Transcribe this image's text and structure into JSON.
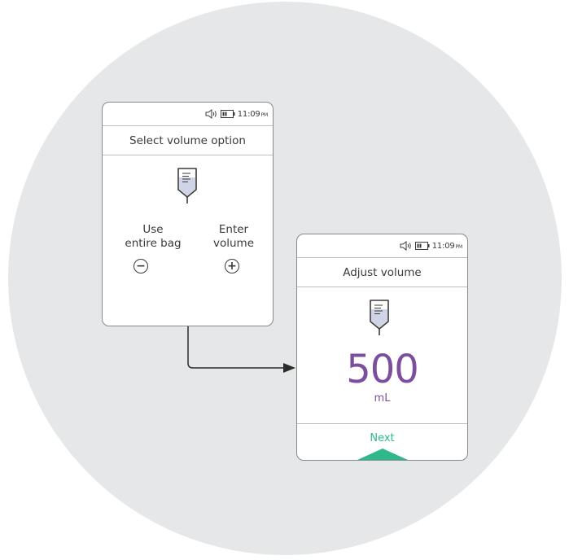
{
  "status_bar": {
    "time": "11:09",
    "ampm": "PM"
  },
  "screen1": {
    "title": "Select volume option",
    "option_entire_bag": {
      "line1": "Use",
      "line2": "entire bag"
    },
    "option_enter_volume": {
      "line1": "Enter",
      "line2": "volume"
    },
    "minus_symbol": "−",
    "plus_symbol": "+"
  },
  "screen2": {
    "title": "Adjust volume",
    "volume_value": "500",
    "volume_unit": "mL",
    "next_label": "Next"
  },
  "colors": {
    "background_circle": "#e6e7e8",
    "volume_purple": "#7b4f9e",
    "next_green": "#2fb98a",
    "text_dark": "#3a3a3a"
  },
  "icons": [
    "speaker-icon",
    "battery-icon",
    "iv-bag-icon",
    "minus-circle-icon",
    "plus-circle-icon",
    "next-arrow-icon"
  ]
}
